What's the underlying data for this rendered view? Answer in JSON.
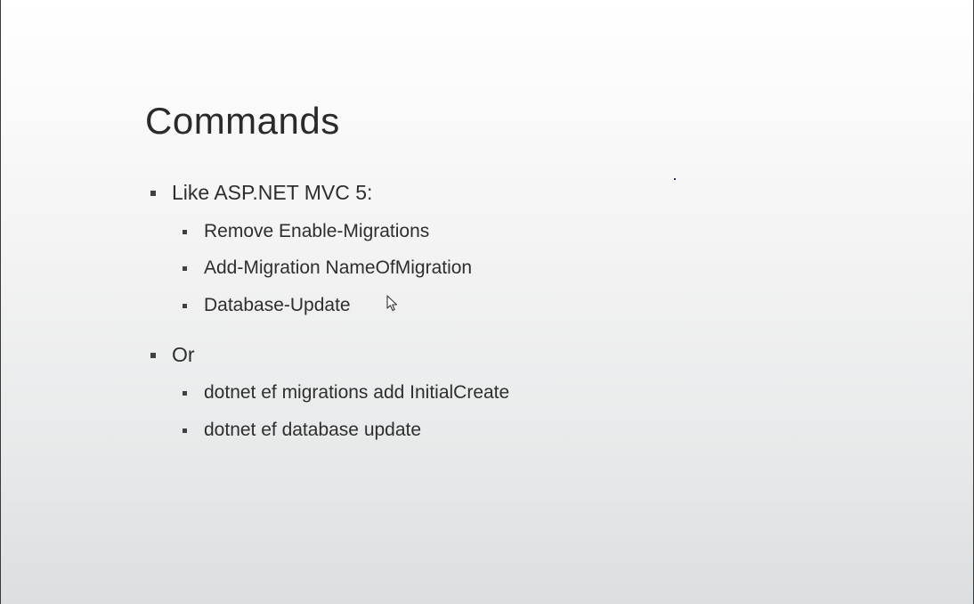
{
  "slide": {
    "title": "Commands",
    "bullets": [
      {
        "label": "Like ASP.NET MVC 5:",
        "children": [
          "Remove Enable-Migrations",
          "Add-Migration NameOfMigration",
          "Database-Update"
        ]
      },
      {
        "label": "Or",
        "children": [
          "dotnet ef migrations add InitialCreate",
          "dotnet ef database update"
        ]
      }
    ]
  },
  "icons": {
    "cursor": "mouse-pointer-icon"
  }
}
